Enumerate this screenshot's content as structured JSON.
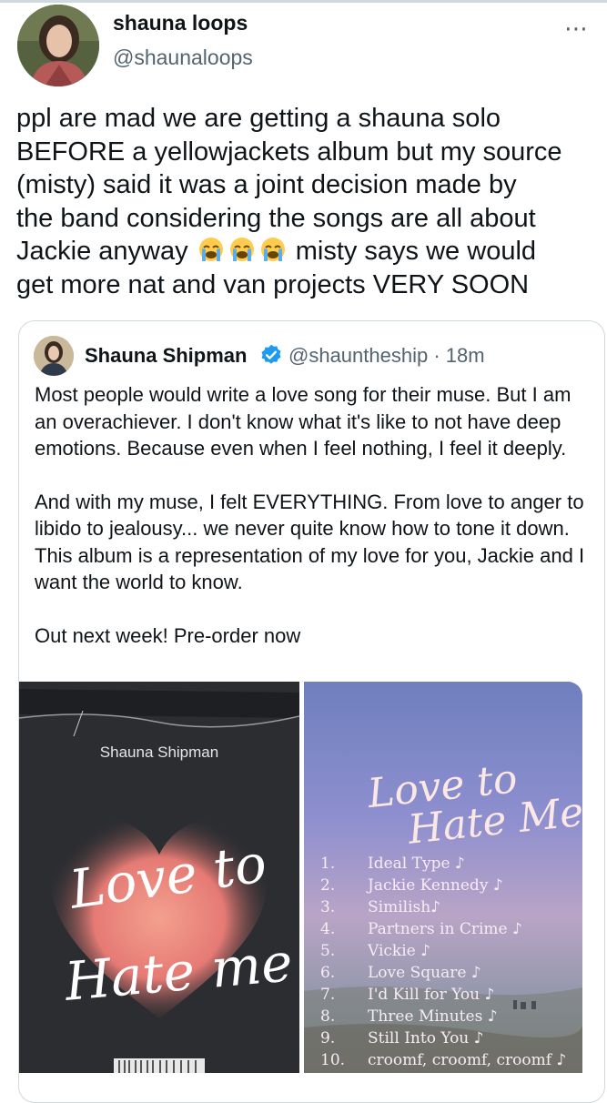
{
  "tweet": {
    "author_name": "shauna loops",
    "author_handle": "@shaunaloops",
    "more_icon": "⋯",
    "text_lines": [
      "ppl are mad we are getting a shauna solo",
      "BEFORE a yellowjackets album but my source",
      "(misty) said it was a joint decision made by",
      "the band considering the songs are all about",
      "Jackie anyway",
      "misty says we would",
      "get more nat and van projects VERY SOON"
    ],
    "emoji_icon": "loudly-crying-face-emoji"
  },
  "quoted_tweet": {
    "author_name": "Shauna Shipman",
    "author_handle": "@shauntheship",
    "separator": "·",
    "timestamp": "18m",
    "paragraphs": [
      "Most people would write a love song for their muse. But I am an overachiever. I don't know what it's like to not have deep emotions. Because even when I feel nothing, I feel it deeply.",
      "And with my muse, I felt EVERYTHING. From love to anger to libido to jealousy... we never quite know how to tone it down. This album is a representation of my love for you, Jackie and I want the world to know.",
      "Out next week! Pre-order now"
    ],
    "album_cover": {
      "artist": "Shauna Shipman",
      "title_line1": "Love to",
      "title_line2": "Hate me"
    },
    "album_back": {
      "title_line1": "Love to",
      "title_line2": "Hate Me",
      "tracks": [
        {
          "num": "1.",
          "title": "Ideal Type ♪"
        },
        {
          "num": "2.",
          "title": "Jackie Kennedy ♪"
        },
        {
          "num": "3.",
          "title": "Similish♪"
        },
        {
          "num": "4.",
          "title": "Partners in Crime ♪"
        },
        {
          "num": "5.",
          "title": "Vickie ♪"
        },
        {
          "num": "6.",
          "title": "Love Square ♪"
        },
        {
          "num": "7.",
          "title": "I'd Kill for You ♪"
        },
        {
          "num": "8.",
          "title": "Three Minutes ♪"
        },
        {
          "num": "9.",
          "title": "Still Into You ♪"
        },
        {
          "num": "10.",
          "title": "croomf, croomf, croomf ♪"
        }
      ]
    }
  },
  "colors": {
    "text": "#0f1419",
    "secondary": "#536471",
    "border": "#cfd9de",
    "verified": "#1d9bf0",
    "cover_bg": "#2b2d31",
    "heart": "#f0877f"
  }
}
